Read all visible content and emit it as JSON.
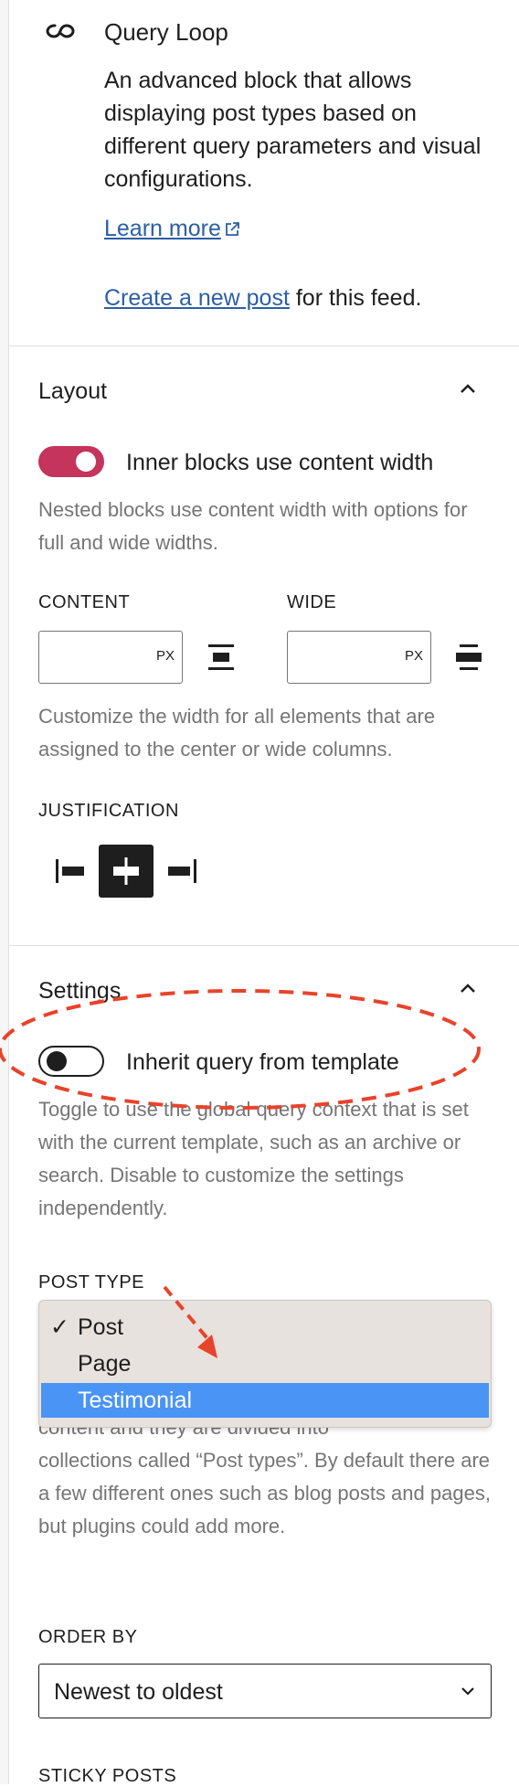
{
  "block": {
    "icon": "query-loop-icon",
    "title": "Query Loop",
    "description": "An advanced block that allows displaying post types based on different query parameters and visual configurations.",
    "learn_more": "Learn more",
    "create_link": "Create a new post",
    "create_suffix": " for this feed."
  },
  "layout": {
    "title": "Layout",
    "toggle_label": "Inner blocks use content width",
    "toggle_on": true,
    "help": "Nested blocks use content width with options for full and wide widths.",
    "content_label": "CONTENT",
    "wide_label": "WIDE",
    "unit": "PX",
    "width_help": "Customize the width for all elements that are assigned to the center or wide columns.",
    "justification_label": "JUSTIFICATION"
  },
  "settings": {
    "title": "Settings",
    "toggle_label": "Inherit query from template",
    "toggle_on": false,
    "help": "Toggle to use the global query context that is set with the current template, such as an archive or search. Disable to customize the settings independently.",
    "post_type_label": "POST TYPE",
    "post_type_options": [
      "Post",
      "Page",
      "Testimonial"
    ],
    "post_type_checked": "Post",
    "post_type_highlighted": "Testimonial",
    "post_type_help_line1": "content and they are divided into",
    "post_type_help_rest": "collections called “Post types”. By default there are a few different ones such as blog posts and pages, but plugins could add more.",
    "order_by_label": "ORDER BY",
    "order_by_value": "Newest to oldest",
    "sticky_label": "STICKY POSTS"
  },
  "colors": {
    "accent": "#c5345c",
    "link": "#2b5fa5",
    "highlight": "#4a94f5",
    "annotation": "#e8432b"
  }
}
